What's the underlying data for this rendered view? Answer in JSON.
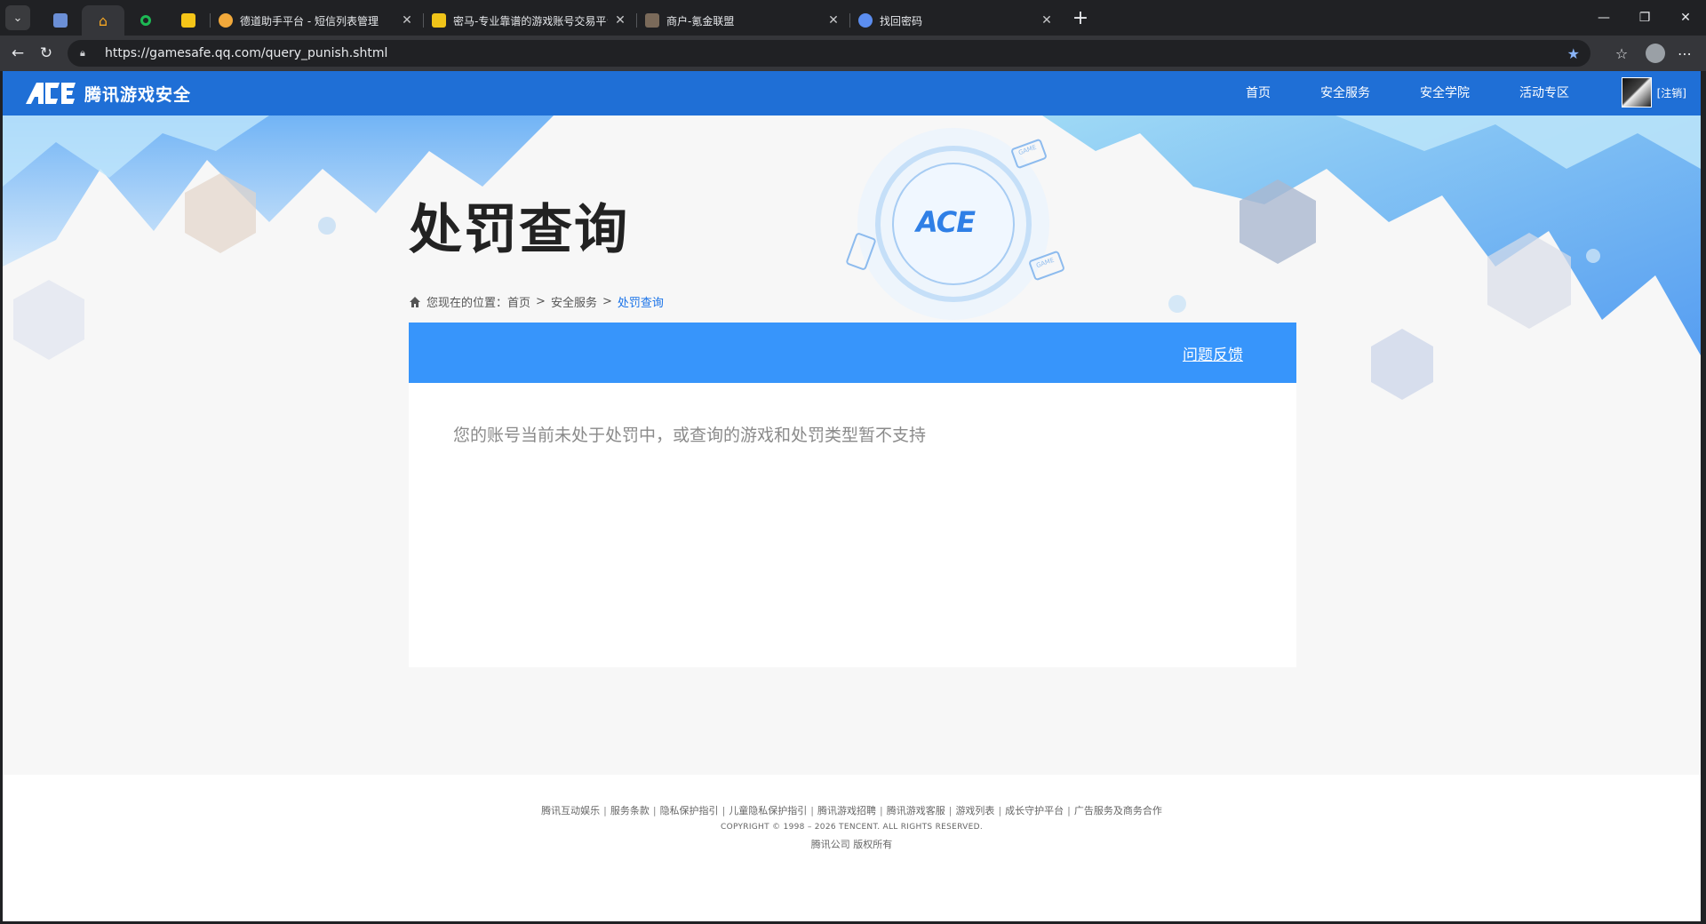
{
  "browser": {
    "tabs": [
      {
        "title": "德道助手平台 - 短信列表管理",
        "favicon_color": "#f2a93b"
      },
      {
        "title": "密马-专业靠谱的游戏账号交易平台",
        "favicon_color": "#f0c419"
      },
      {
        "title": "商户-氪金联盟",
        "favicon_color": "#7a6a5a"
      },
      {
        "title": "找回密码",
        "favicon_color": "#5b8def"
      }
    ],
    "pinned_tabs": [
      {
        "name": "pinned-tab-1",
        "color": "#6b8fd6"
      },
      {
        "name": "pinned-tab-2",
        "color": "#f5a623"
      },
      {
        "name": "pinned-tab-3",
        "color": "#1db954"
      },
      {
        "name": "pinned-tab-4",
        "color": "#f5c518"
      }
    ],
    "url": "https://gamesafe.qq.com/query_punish.shtml"
  },
  "site": {
    "logo_text": "腾讯游戏安全",
    "logo_mark": "ACE",
    "nav": [
      "首页",
      "安全服务",
      "安全学院",
      "活动专区"
    ],
    "logout": "[注销]"
  },
  "page": {
    "title": "处罚查询",
    "breadcrumb": {
      "prefix": "您现在的位置：",
      "items": [
        "首页",
        "安全服务"
      ],
      "current": "处罚查询",
      "separator": ">"
    },
    "feedback": "问题反馈",
    "message": "您的账号当前未处于处罚中，或查询的游戏和处罚类型暂不支持",
    "hero_badge": "ACE",
    "hero_tag": "GAME"
  },
  "footer": {
    "links": [
      "腾讯互动娱乐",
      "服务条款",
      "隐私保护指引",
      "儿童隐私保护指引",
      "腾讯游戏招聘",
      "腾讯游戏客服",
      "游戏列表",
      "成长守护平台",
      "广告服务及商务合作"
    ],
    "copyright": "COPYRIGHT © 1998 – 2026 TENCENT. ALL RIGHTS RESERVED.",
    "company": "腾讯公司 版权所有"
  },
  "colors": {
    "header_blue": "#1f6fd6",
    "card_header_blue": "#3795fb",
    "breadcrumb_current": "#1a73e8"
  }
}
